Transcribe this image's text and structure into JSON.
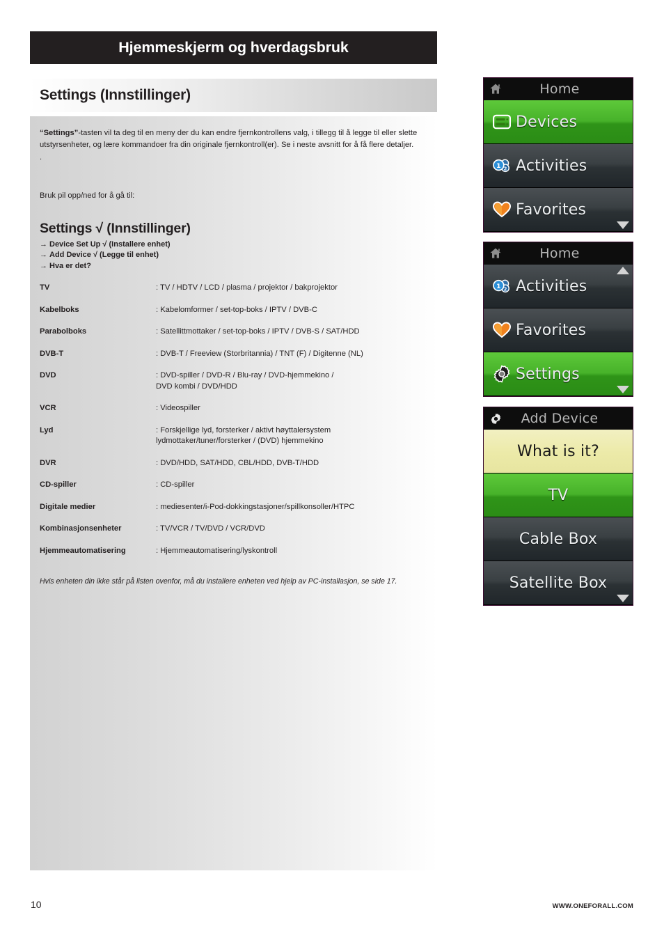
{
  "chapter": {
    "title": "Hjemmeskjerm og hverdagsbruk"
  },
  "section": {
    "title": "Settings (Innstillinger)"
  },
  "body": {
    "intro_bold": "“Settings”",
    "intro_rest": "-tasten vil ta deg til en meny der du kan endre fjernkontrollens valg, i tillegg til å legge til eller slette utstyrsenheter, og lære kommandoer fra din originale fjernkontroll(er). Se i neste avsnitt for å få flere detaljer.",
    "lone_dot": ".",
    "bruk_line": "Bruk pil opp/ned for å gå til:",
    "settings_heading": "Settings  √ (Innstillinger)",
    "arrow_items": [
      "Device Set Up √ (Installere enhet)",
      "Add Device √ (Legge til enhet)",
      "Hva er det?"
    ],
    "footnote": "Hvis enheten din ikke står på listen ovenfor, må du installere enheten ved hjelp av PC-installasjon, se side 17."
  },
  "device_table": [
    {
      "term": "TV",
      "desc": ": TV / HDTV / LCD / plasma / projektor / bakprojektor"
    },
    {
      "term": "Kabelboks",
      "desc": ": Kabelomformer / set-top-boks / IPTV / DVB-C"
    },
    {
      "term": "Parabolboks",
      "desc": ": Satellittmottaker / set-top-boks / IPTV / DVB-S / SAT/HDD"
    },
    {
      "term": "DVB-T",
      "desc": ": DVB-T / Freeview (Storbritannia) / TNT (F) / Digitenne (NL)"
    },
    {
      "term": "DVD",
      "desc": ": DVD-spiller / DVD-R / Blu-ray / DVD-hjemmekino /\n DVD kombi / DVD/HDD"
    },
    {
      "term": "VCR",
      "desc": ": Videospiller"
    },
    {
      "term": "Lyd",
      "desc": ": Forskjellige lyd, forsterker / aktivt høyttalersystem\n lydmottaker/tuner/forsterker / (DVD) hjemmekino"
    },
    {
      "term": "DVR",
      "desc": ": DVD/HDD, SAT/HDD, CBL/HDD, DVB-T/HDD"
    },
    {
      "term": "CD-spiller",
      "desc": ": CD-spiller"
    },
    {
      "term": "Digitale medier",
      "desc": ": mediesenter/i-Pod-dokkingstasjoner/spillkonsoller/HTPC"
    },
    {
      "term": "Kombinasjonsenheter",
      "desc": ": TV/VCR / TV/DVD / VCR/DVD"
    },
    {
      "term": "Hjemmeautomatisering",
      "desc": ": Hjemmeautomatisering/lyskontroll"
    }
  ],
  "screens": [
    {
      "id": "home-devices",
      "header_title": "Home",
      "header_icon": "home-icon",
      "scroll_down": true,
      "scroll_up": false,
      "rows": [
        {
          "label": "Devices",
          "icon": "devices-icon",
          "state": "green"
        },
        {
          "label": "Activities",
          "icon": "activities-icon",
          "state": "dark"
        },
        {
          "label": "Favorites",
          "icon": "heart-icon",
          "state": "dark"
        }
      ]
    },
    {
      "id": "home-settings",
      "header_title": "Home",
      "header_icon": "home-icon",
      "scroll_down": true,
      "scroll_up": true,
      "rows": [
        {
          "label": "Activities",
          "icon": "activities-icon",
          "state": "dark"
        },
        {
          "label": "Favorites",
          "icon": "heart-icon",
          "state": "dark"
        },
        {
          "label": "Settings",
          "icon": "gear-icon",
          "state": "green"
        }
      ]
    },
    {
      "id": "add-device",
      "header_title": "Add Device",
      "header_icon": "gear-icon",
      "scroll_down": true,
      "scroll_up": false,
      "rows": [
        {
          "label": "What is it?",
          "icon": "none",
          "state": "cream"
        },
        {
          "label": "TV",
          "icon": "none",
          "state": "green"
        },
        {
          "label": "Cable Box",
          "icon": "none",
          "state": "dark"
        },
        {
          "label": "Satellite Box",
          "icon": "none",
          "state": "dark"
        }
      ]
    }
  ],
  "footer": {
    "page_number": "10",
    "site_url": "WWW.ONEFORALL.COM"
  },
  "colors": {
    "chapter_bar": "#231f20",
    "green_row": "#47b22a",
    "cream_row": "#eceaa8",
    "dark_row": "#3a4043",
    "screen_header": "#0d0d0d"
  }
}
